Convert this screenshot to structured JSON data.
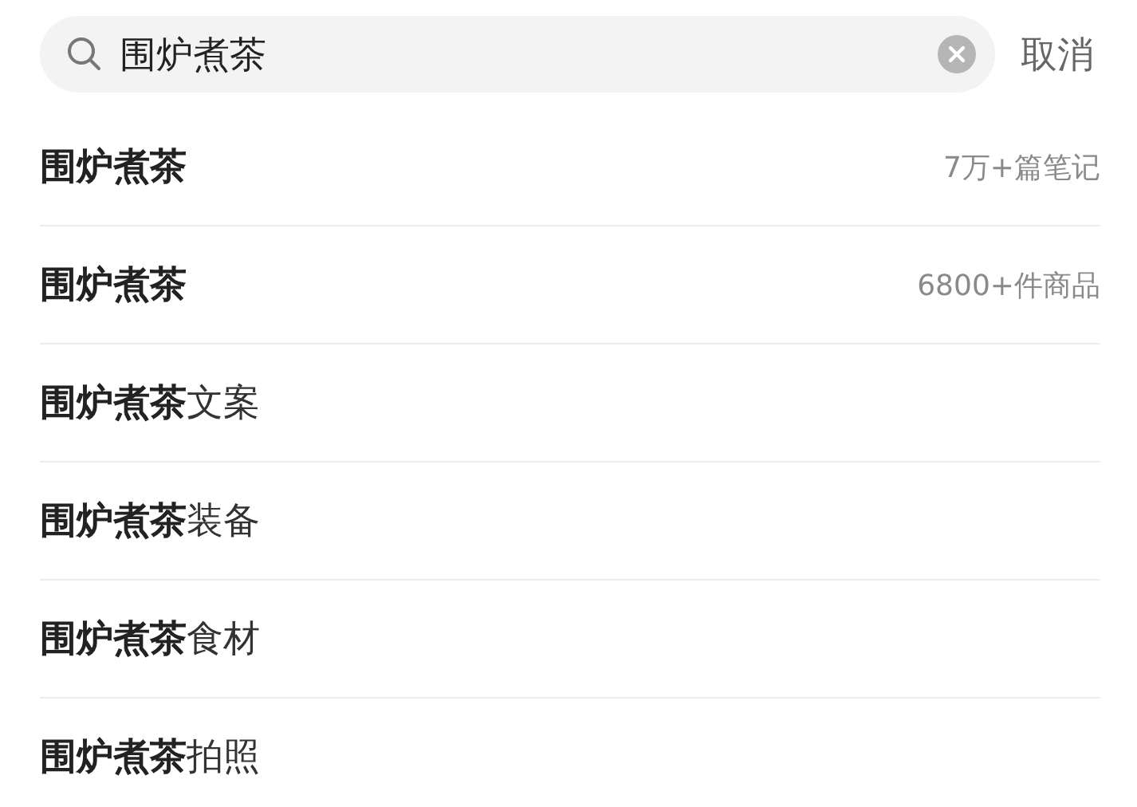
{
  "search": {
    "value": "围炉煮茶"
  },
  "cancel": "取消",
  "suggestions": [
    {
      "text": "**围炉煮茶**",
      "meta": "7万+篇笔记"
    },
    {
      "text": "**围炉煮茶**",
      "meta": "6800+件商品"
    },
    {
      "text": "**围炉煮茶**文案"
    },
    {
      "text": "**围炉煮茶**装备"
    },
    {
      "text": "**围炉煮茶**食材"
    },
    {
      "text": "**围炉煮茶**拍照"
    }
  ]
}
